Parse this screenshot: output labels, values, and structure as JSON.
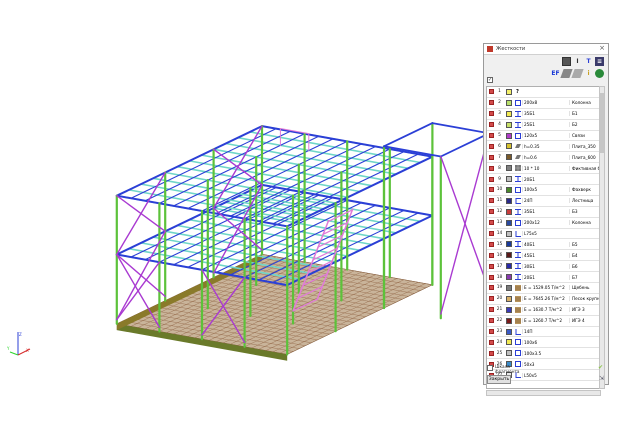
{
  "panel": {
    "title": "Жесткости",
    "close_glyph": "×",
    "fragment_label": "Шкала фрагмента",
    "close_button": "Закрыть"
  },
  "icons": {
    "toolbar_top": [
      "list-icon",
      "i-beam-icon",
      "section-icon",
      "settings-icon"
    ],
    "toolbar_bottom": [
      "ef-icon",
      "plate-icon",
      "eraser-icon",
      "info-icon",
      "globe-icon"
    ]
  },
  "rows": [
    {
      "num": "1",
      "color": "#f4f06a",
      "icon": "?",
      "name": "",
      "note": ""
    },
    {
      "num": "2",
      "color": "#b8e06a",
      "icon": "box",
      "name": "200x8",
      "note": "Колонна"
    },
    {
      "num": "3",
      "color": "#f2ea52",
      "icon": "ibeam",
      "name": "35Б1",
      "note": "Б1"
    },
    {
      "num": "4",
      "color": "#c7e06a",
      "icon": "ibeam",
      "name": "25Б1",
      "note": "Б2"
    },
    {
      "num": "5",
      "color": "#b03cc8",
      "icon": "box",
      "name": "120x5",
      "note": "Связи"
    },
    {
      "num": "6",
      "color": "#d6c230",
      "icon": "plate",
      "name": "h=0.35",
      "note": "Плита_350"
    },
    {
      "num": "7",
      "color": "#7a5a2a",
      "icon": "plate",
      "name": "h=0.6",
      "note": "Плита_600"
    },
    {
      "num": "8",
      "color": "#808080",
      "icon": "grid",
      "name": "10 * 10",
      "note": "Фиктивная бал"
    },
    {
      "num": "9",
      "color": "#c0c0c0",
      "icon": "ibeam",
      "name": "20Б1",
      "note": ""
    },
    {
      "num": "10",
      "color": "#4a8a2a",
      "icon": "box",
      "name": "100x5",
      "note": "Фахверк"
    },
    {
      "num": "11",
      "color": "#2a2a8a",
      "icon": "channel",
      "name": "24П",
      "note": "Лестница"
    },
    {
      "num": "12",
      "color": "#c83c3c",
      "icon": "ibeam",
      "name": "35Б1",
      "note": "Б3"
    },
    {
      "num": "13",
      "color": "#2a4aa0",
      "icon": "box",
      "name": "200x12",
      "note": "Колонна"
    },
    {
      "num": "14",
      "color": "#c0c0c0",
      "icon": "angle",
      "name": "L75x5",
      "note": ""
    },
    {
      "num": "15",
      "color": "#1a3a9a",
      "icon": "ibeam",
      "name": "40Б1",
      "note": "Б5"
    },
    {
      "num": "16",
      "color": "#5a1a1a",
      "icon": "ibeam",
      "name": "45Б1",
      "note": "Б4"
    },
    {
      "num": "17",
      "color": "#2a2aa8",
      "icon": "ibeam",
      "name": "30Б1",
      "note": "Б6"
    },
    {
      "num": "18",
      "color": "#8a3ab0",
      "icon": "ibeam",
      "name": "20Б1",
      "note": "Б7"
    },
    {
      "num": "19",
      "color": "#7a7a7a",
      "icon": "soil",
      "name": "E = 1529.05 Т/м^2",
      "note": "Щебень"
    },
    {
      "num": "20",
      "color": "#d8b068",
      "icon": "soil",
      "name": "E = 7645.26 Т/м^2",
      "note": "Песок крупный"
    },
    {
      "num": "21",
      "color": "#3a3ab8",
      "icon": "soil",
      "name": "E = 1630.7 Т/м^2",
      "note": "ИГЭ 3"
    },
    {
      "num": "22",
      "color": "#7a1a1a",
      "icon": "soil",
      "name": "E = 1260.7 Т/м^2",
      "note": "ИГЭ 4"
    },
    {
      "num": "23",
      "color": "#3a5ac8",
      "icon": "angle",
      "name": "14П",
      "note": ""
    },
    {
      "num": "24",
      "color": "#f2ea52",
      "icon": "box",
      "name": "100x6",
      "note": ""
    },
    {
      "num": "25",
      "color": "#c0c0c0",
      "icon": "box",
      "name": "100x3.5",
      "note": ""
    },
    {
      "num": "26",
      "color": "#3a8ac8",
      "icon": "box",
      "name": "50x3",
      "note": ""
    },
    {
      "num": "27",
      "color": "#e8e8e8",
      "icon": "angle",
      "name": "L50x5",
      "note": ""
    }
  ],
  "colors": {
    "column_green": "#5cc23a",
    "beam_blue": "#2b3fd6",
    "beam_cyan": "#6fd6c8",
    "brace_purple": "#a93ad1",
    "stair_pink": "#e07ad8",
    "slab_brown": "#8a5a3a",
    "foundation_olive": "#9a8a2a"
  }
}
